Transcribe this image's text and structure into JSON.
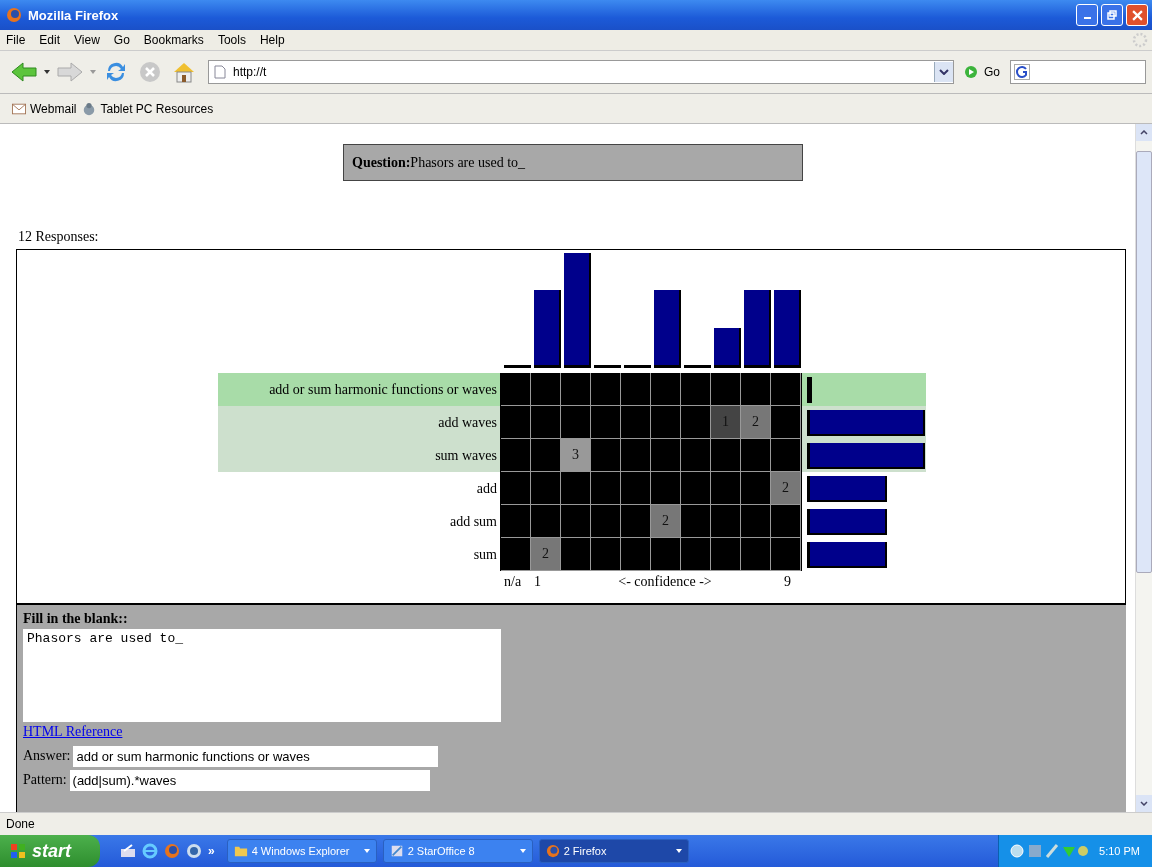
{
  "window": {
    "title": "Mozilla Firefox"
  },
  "menu": [
    "File",
    "Edit",
    "View",
    "Go",
    "Bookmarks",
    "Tools",
    "Help"
  ],
  "toolbar": {
    "url": "http://t",
    "go": "Go"
  },
  "bookmarks": [
    "Webmail",
    "Tablet PC Resources"
  ],
  "question": {
    "label": "Question:",
    "text": "Phasors are used to_"
  },
  "responses": "12 Responses:",
  "histogram": [
    {
      "level": 0
    },
    {
      "level": 0.667
    },
    {
      "level": 1
    },
    {
      "level": 0
    },
    {
      "level": 0
    },
    {
      "level": 0.667
    },
    {
      "level": 0
    },
    {
      "level": 0.333
    },
    {
      "level": 0.667
    },
    {
      "level": 0.667
    }
  ],
  "rows": [
    {
      "label": "add or sum harmonic functions or waves",
      "kind": "answer",
      "cells": [
        null,
        null,
        null,
        null,
        null,
        null,
        null,
        null,
        null,
        null
      ],
      "level": 0
    },
    {
      "label": "add waves",
      "kind": "match",
      "cells": [
        null,
        null,
        null,
        null,
        null,
        null,
        null,
        "1",
        "2",
        null
      ],
      "level": 1
    },
    {
      "label": "sum waves",
      "kind": "match",
      "cells": [
        null,
        null,
        "3",
        null,
        null,
        null,
        null,
        null,
        null,
        null
      ],
      "level": 1
    },
    {
      "label": "add",
      "kind": "other",
      "cells": [
        null,
        null,
        null,
        null,
        null,
        null,
        null,
        null,
        null,
        "2"
      ],
      "level": 0.667
    },
    {
      "label": "add sum",
      "kind": "other",
      "cells": [
        null,
        null,
        null,
        null,
        null,
        "2",
        null,
        null,
        null,
        null
      ],
      "level": 0.667
    },
    {
      "label": "sum",
      "kind": "other",
      "cells": [
        null,
        "2",
        null,
        null,
        null,
        null,
        null,
        null,
        null,
        null
      ],
      "level": 0.667
    }
  ],
  "axis": [
    "n/a",
    "1",
    "<- confidence ->",
    "9"
  ],
  "form": {
    "title": "Fill in the blank::",
    "question": "Phasors are used to_",
    "link": "HTML Reference",
    "answer_label": "Answer:",
    "answer": "add or sum harmonic functions or waves",
    "pattern_label": "Pattern:",
    "pattern": "(add|sum).*waves"
  },
  "status_bar": "Done",
  "taskbar": {
    "start": "start",
    "overflow": "»",
    "tasks": [
      {
        "label": "4 Windows Explorer",
        "selected": false
      },
      {
        "label": "2 StarOffice 8",
        "selected": false
      },
      {
        "label": "2 Firefox",
        "selected": true
      }
    ],
    "clock": "5:10 PM"
  }
}
